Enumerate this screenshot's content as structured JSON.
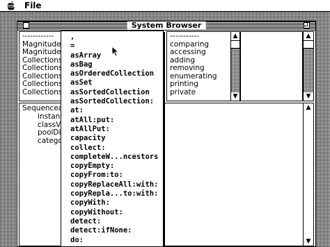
{
  "menubar": {
    "apple_icon": "apple-icon",
    "file_label": "File"
  },
  "window": {
    "title": "System Browser"
  },
  "class_pane": {
    "items": [
      "------------",
      "Magnitude-C",
      "Magnitude-N",
      "Collections-",
      "Collections-",
      "Collections-",
      "Collections-",
      "Collections-"
    ]
  },
  "protocol_pane": {
    "items": [
      "-----------",
      "comparing",
      "accessing",
      "adding",
      "removing",
      "enumerating",
      "printing",
      "private"
    ]
  },
  "code_pane": {
    "lines": [
      "Sequenceab",
      "instance",
      "classVa",
      "poolDic",
      "categor"
    ]
  },
  "popup_menu": {
    "items": [
      ",",
      "=",
      "asArray",
      "asBag",
      "asOrderedCollection",
      "asSet",
      "asSortedCollection",
      "asSortedCollection:",
      "at:",
      "atAll:put:",
      "atAllPut:",
      "capacity",
      "collect:",
      "completeW...ncestors",
      "copyEmpty:",
      "copyFrom:to:",
      "copyReplaceAll:with:",
      "copyRepla...to:with:",
      "copyWith:",
      "copyWithout:",
      "detect:",
      "detect:ifNone:",
      "do:"
    ]
  },
  "icons": {
    "cursor": "arrow-cursor-icon",
    "close": "close-box-icon",
    "zoom": "zoom-box-icon",
    "scroll_up": "scroll-up-arrow-icon",
    "scroll_down": "scroll-down-arrow-icon"
  }
}
